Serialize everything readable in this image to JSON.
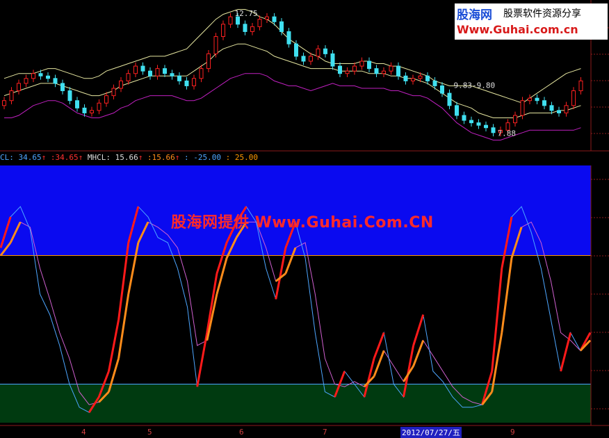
{
  "logo": {
    "site_name": "股海网",
    "tagline": "股票软件资源分享",
    "url": "Www.Guhai.com.cn"
  },
  "watermark": "股海网提供 Www.Guhai.Com.CN",
  "legend": {
    "item1_name": "CL: 34.65",
    "item1_value": ":34.65",
    "item2_name": "MHCL: 15.66",
    "item2_value": ":15.66",
    "item3": ": -25.00",
    "item4": ": 25.00",
    "up_arrow": "↑"
  },
  "x_labels": [
    "4",
    "5",
    "6",
    "7",
    "9"
  ],
  "date_label": "2012/07/27/五",
  "colors": {
    "band_upper": "#0a0af0",
    "band_lower": "#003a10",
    "up_candle": "#ff2020",
    "down_candle": "#40e0f0",
    "boll_upper": "#e6e6a0",
    "boll_lower": "#c020c0",
    "kd_red": "#ff1a1a",
    "kd_orange": "#ff8c1a",
    "kd_blue": "#4da6ff",
    "kd_magenta": "#d060d0"
  },
  "chart_data": [
    {
      "type": "candlestick",
      "title": "",
      "annotations": [
        "12.75",
        "9.83-9.80",
        "7.88"
      ],
      "ylim": [
        7.5,
        13.0
      ],
      "series": [
        {
          "name": "",
          "kind": "close",
          "values": [
            9.2,
            9.6,
            9.9,
            10.1,
            10.3,
            10.2,
            10.1,
            9.9,
            9.6,
            9.2,
            8.9,
            8.7,
            8.8,
            9.1,
            9.4,
            9.7,
            10.0,
            10.3,
            10.6,
            10.4,
            10.2,
            10.5,
            10.3,
            10.2,
            10.0,
            9.8,
            10.1,
            10.5,
            11.1,
            11.8,
            12.3,
            12.6,
            12.3,
            12.0,
            12.2,
            12.5,
            12.6,
            12.4,
            12.0,
            11.5,
            11.0,
            10.8,
            11.0,
            11.3,
            11.1,
            10.6,
            10.3,
            10.4,
            10.6,
            10.8,
            10.5,
            10.3,
            10.4,
            10.6,
            10.2,
            10.0,
            10.1,
            10.2,
            10.0,
            9.8,
            9.5,
            9.0,
            8.6,
            8.4,
            8.3,
            8.2,
            8.1,
            7.9,
            8.0,
            8.3,
            8.6,
            9.2,
            9.3,
            9.2,
            9.0,
            8.8,
            8.7,
            9.0,
            9.6,
            10.0
          ]
        },
        {
          "name": "",
          "kind": "boll_upper",
          "values": [
            10.1,
            10.2,
            10.3,
            10.3,
            10.3,
            10.4,
            10.5,
            10.5,
            10.4,
            10.3,
            10.2,
            10.1,
            10.1,
            10.2,
            10.4,
            10.5,
            10.6,
            10.7,
            10.8,
            10.9,
            11.0,
            11.0,
            11.0,
            11.1,
            11.2,
            11.3,
            11.6,
            11.9,
            12.2,
            12.5,
            12.7,
            12.8,
            12.9,
            12.9,
            12.8,
            12.6,
            12.5,
            12.3,
            12.0,
            11.7,
            11.5,
            11.3,
            11.1,
            11.0,
            10.8,
            10.7,
            10.7,
            10.7,
            10.7,
            10.8,
            10.8,
            10.7,
            10.7,
            10.6,
            10.6,
            10.5,
            10.4,
            10.3,
            10.2,
            10.0,
            9.9,
            9.8,
            9.8,
            9.8,
            9.8,
            9.7,
            9.6,
            9.5,
            9.4,
            9.3,
            9.2,
            9.1,
            9.3,
            9.5,
            9.7,
            9.9,
            10.1,
            10.3,
            10.4,
            10.5
          ]
        },
        {
          "name": "",
          "kind": "boll_mid",
          "values": [
            9.4,
            9.5,
            9.6,
            9.7,
            9.8,
            9.9,
            9.9,
            9.9,
            9.8,
            9.7,
            9.6,
            9.5,
            9.4,
            9.4,
            9.5,
            9.6,
            9.8,
            9.9,
            10.0,
            10.1,
            10.2,
            10.2,
            10.2,
            10.2,
            10.2,
            10.2,
            10.4,
            10.6,
            10.8,
            11.1,
            11.3,
            11.4,
            11.5,
            11.5,
            11.4,
            11.3,
            11.2,
            11.0,
            10.9,
            10.8,
            10.7,
            10.6,
            10.5,
            10.5,
            10.5,
            10.5,
            10.4,
            10.4,
            10.4,
            10.4,
            10.3,
            10.3,
            10.3,
            10.2,
            10.2,
            10.1,
            10.1,
            10.0,
            9.9,
            9.7,
            9.5,
            9.3,
            9.1,
            9.0,
            8.9,
            8.7,
            8.6,
            8.5,
            8.5,
            8.5,
            8.5,
            8.6,
            8.7,
            8.7,
            8.7,
            8.7,
            8.8,
            8.8,
            8.9,
            9.0
          ]
        },
        {
          "name": "",
          "kind": "boll_lower",
          "values": [
            8.5,
            8.5,
            8.6,
            8.8,
            9.0,
            9.1,
            9.2,
            9.2,
            9.1,
            8.9,
            8.7,
            8.6,
            8.5,
            8.5,
            8.6,
            8.7,
            8.9,
            9.0,
            9.2,
            9.3,
            9.4,
            9.4,
            9.4,
            9.4,
            9.3,
            9.2,
            9.2,
            9.3,
            9.5,
            9.7,
            9.9,
            10.1,
            10.2,
            10.3,
            10.3,
            10.3,
            10.2,
            10.0,
            9.9,
            9.8,
            9.8,
            9.7,
            9.6,
            9.7,
            9.8,
            9.9,
            9.8,
            9.8,
            9.8,
            9.7,
            9.7,
            9.7,
            9.7,
            9.6,
            9.6,
            9.5,
            9.4,
            9.4,
            9.3,
            9.1,
            8.9,
            8.6,
            8.3,
            8.1,
            7.9,
            7.8,
            7.7,
            7.6,
            7.6,
            7.7,
            7.8,
            7.9,
            8.0,
            8.0,
            8.0,
            8.0,
            8.0,
            8.0,
            8.0,
            8.1
          ]
        }
      ]
    },
    {
      "type": "line",
      "title": "",
      "ylim": [
        -40,
        60
      ],
      "bands": [
        {
          "from": 25,
          "to": 60,
          "color": "#0a0af0"
        },
        {
          "from": -40,
          "to": -25,
          "color": "#003a10"
        }
      ],
      "x_tick_labels": [
        "4",
        "5",
        "6",
        "7",
        "9"
      ],
      "series": [
        {
          "name": "CL",
          "values": [
            28,
            40,
            44,
            35,
            10,
            2,
            -10,
            -25,
            -34,
            -36,
            -30,
            -20,
            0,
            30,
            44,
            40,
            32,
            30,
            20,
            5,
            -26,
            -5,
            18,
            30,
            38,
            44,
            38,
            20,
            8,
            28,
            38,
            24,
            -5,
            -28,
            -30,
            -20,
            -25,
            -30,
            -15,
            -5,
            -25,
            -30,
            -10,
            2,
            -20,
            -24,
            -30,
            -34,
            -34,
            -33,
            -20,
            20,
            40,
            44,
            34,
            20,
            0,
            -20,
            -5,
            -12,
            -5
          ]
        },
        {
          "name": "MHCL",
          "values": [
            25,
            30,
            38,
            36,
            20,
            8,
            -5,
            -15,
            -28,
            -33,
            -32,
            -28,
            -15,
            10,
            30,
            38,
            36,
            33,
            28,
            15,
            -10,
            -8,
            10,
            24,
            32,
            38,
            38,
            28,
            15,
            18,
            28,
            30,
            10,
            -15,
            -25,
            -26,
            -24,
            -26,
            -22,
            -12,
            -18,
            -24,
            -18,
            -8,
            -14,
            -20,
            -26,
            -30,
            -32,
            -33,
            -28,
            -5,
            24,
            36,
            38,
            30,
            15,
            -5,
            -8,
            -12,
            -8
          ]
        }
      ]
    }
  ]
}
